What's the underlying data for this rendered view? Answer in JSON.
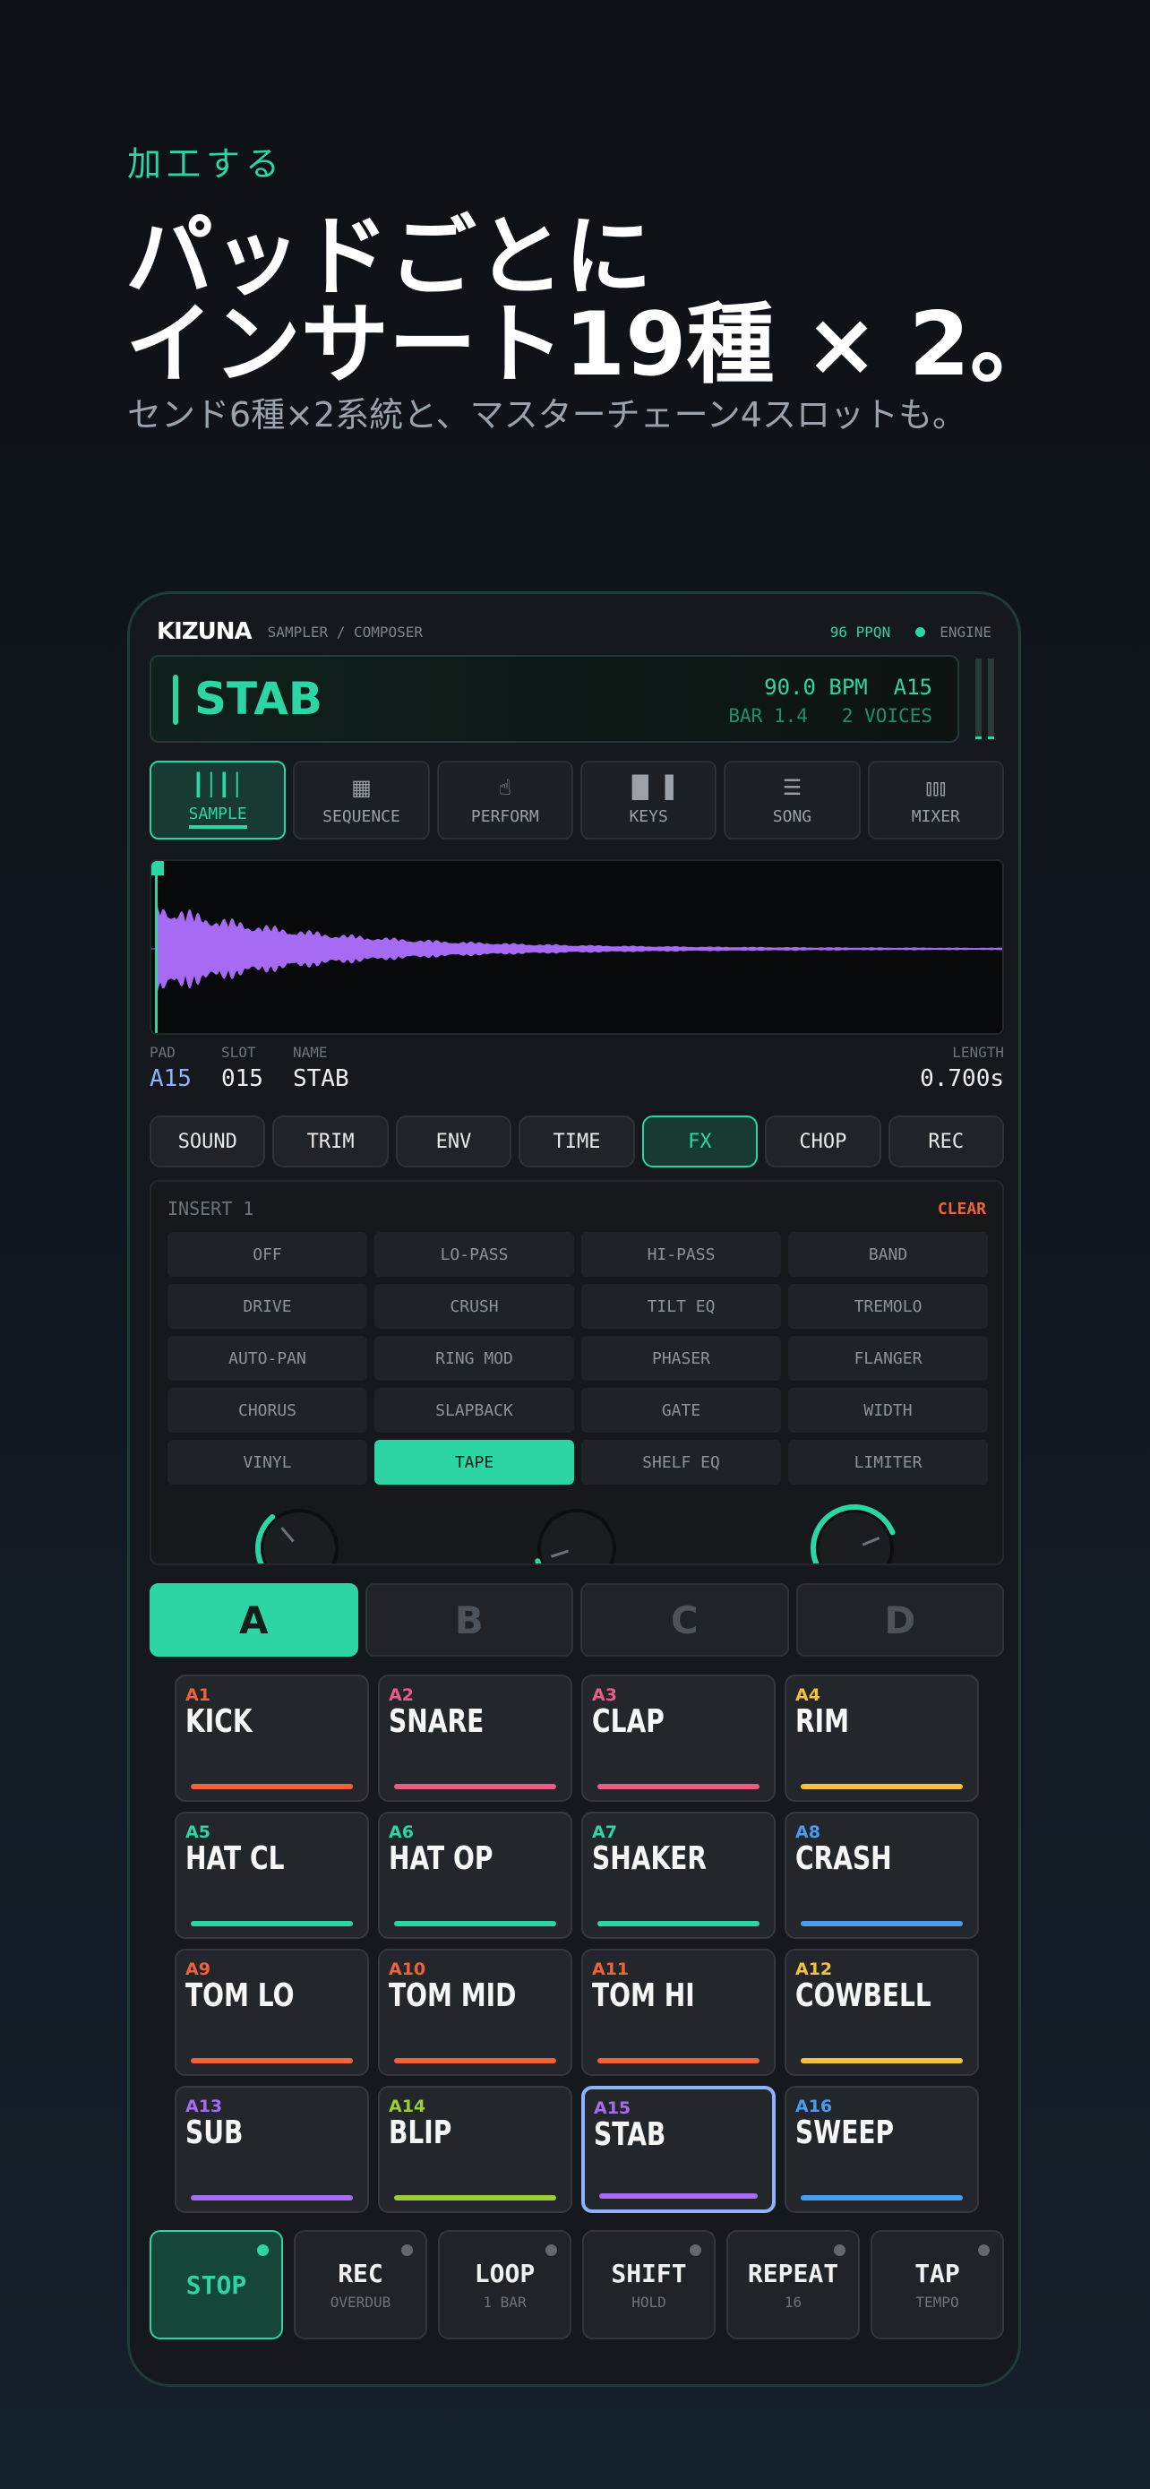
{
  "promo": {
    "kicker": "加工する",
    "headline_1": "パッドごとに",
    "headline_2": "インサート19種 × 2。",
    "subline": "センド6種×2系統と、マスターチェーン4スロットも。"
  },
  "app": {
    "logo": "KIZUNA",
    "subtitle": "SAMPLER / COMPOSER",
    "ppqn": "96 PPQN",
    "engine": "ENGINE"
  },
  "display": {
    "name": "STAB",
    "bpm": "90.0 BPM",
    "pad": "A15",
    "bar": "BAR 1.4",
    "voices": "2 VOICES"
  },
  "tabs": [
    {
      "label": "SAMPLE",
      "icon": "waveform-icon",
      "active": true
    },
    {
      "label": "SEQUENCE",
      "icon": "grid-icon",
      "active": false
    },
    {
      "label": "PERFORM",
      "icon": "hand-tap-icon",
      "active": false
    },
    {
      "label": "KEYS",
      "icon": "piano-keys-icon",
      "active": false
    },
    {
      "label": "SONG",
      "icon": "list-icon",
      "active": false
    },
    {
      "label": "MIXER",
      "icon": "sliders-icon",
      "active": false
    }
  ],
  "sample_info": {
    "pad_label": "PAD",
    "pad_value": "A15",
    "slot_label": "SLOT",
    "slot_value": "015",
    "name_label": "NAME",
    "name_value": "STAB",
    "length_label": "LENGTH",
    "length_value": "0.700s"
  },
  "subtabs": [
    "SOUND",
    "TRIM",
    "ENV",
    "TIME",
    "FX",
    "CHOP",
    "REC"
  ],
  "subtab_active": "FX",
  "fx": {
    "title": "INSERT 1",
    "clear": "CLEAR",
    "options": [
      "OFF",
      "LO-PASS",
      "HI-PASS",
      "BAND",
      "DRIVE",
      "CRUSH",
      "TILT EQ",
      "TREMOLO",
      "AUTO-PAN",
      "RING MOD",
      "PHASER",
      "FLANGER",
      "CHORUS",
      "SLAPBACK",
      "GATE",
      "WIDTH",
      "VINYL",
      "TAPE",
      "SHELF EQ",
      "LIMITER"
    ],
    "selected": "TAPE",
    "knob_levels": [
      0.35,
      0.1,
      0.75
    ]
  },
  "banks": [
    "A",
    "B",
    "C",
    "D"
  ],
  "bank_active": "A",
  "pads": [
    {
      "id": "A1",
      "name": "KICK",
      "color": "#f0633a"
    },
    {
      "id": "A2",
      "name": "SNARE",
      "color": "#ec5a86"
    },
    {
      "id": "A3",
      "name": "CLAP",
      "color": "#ec5a86"
    },
    {
      "id": "A4",
      "name": "RIM",
      "color": "#f2c23c"
    },
    {
      "id": "A5",
      "name": "HAT CL",
      "color": "#2dd4a4"
    },
    {
      "id": "A6",
      "name": "HAT OP",
      "color": "#2dd4a4"
    },
    {
      "id": "A7",
      "name": "SHAKER",
      "color": "#2dd4a4"
    },
    {
      "id": "A8",
      "name": "CRASH",
      "color": "#4a9cf0"
    },
    {
      "id": "A9",
      "name": "TOM LO",
      "color": "#f0633a"
    },
    {
      "id": "A10",
      "name": "TOM MID",
      "color": "#f0633a"
    },
    {
      "id": "A11",
      "name": "TOM HI",
      "color": "#f0633a"
    },
    {
      "id": "A12",
      "name": "COWBELL",
      "color": "#f2c23c"
    },
    {
      "id": "A13",
      "name": "SUB",
      "color": "#a66bf2"
    },
    {
      "id": "A14",
      "name": "BLIP",
      "color": "#9ccc3a"
    },
    {
      "id": "A15",
      "name": "STAB",
      "color": "#a66bf2",
      "selected": true
    },
    {
      "id": "A16",
      "name": "SWEEP",
      "color": "#4a9cf0"
    }
  ],
  "transport": [
    {
      "label": "STOP",
      "sub": "",
      "active": true
    },
    {
      "label": "REC",
      "sub": "OVERDUB",
      "active": false
    },
    {
      "label": "LOOP",
      "sub": "1 BAR",
      "active": false
    },
    {
      "label": "SHIFT",
      "sub": "HOLD",
      "active": false
    },
    {
      "label": "REPEAT",
      "sub": "16",
      "active": false
    },
    {
      "label": "TAP",
      "sub": "TEMPO",
      "active": false
    }
  ],
  "colors": {
    "accent": "#2dd4a4",
    "waveform": "#a66bf2",
    "clear": "#f0633a",
    "selected_pad_border": "#8fb2ff"
  }
}
